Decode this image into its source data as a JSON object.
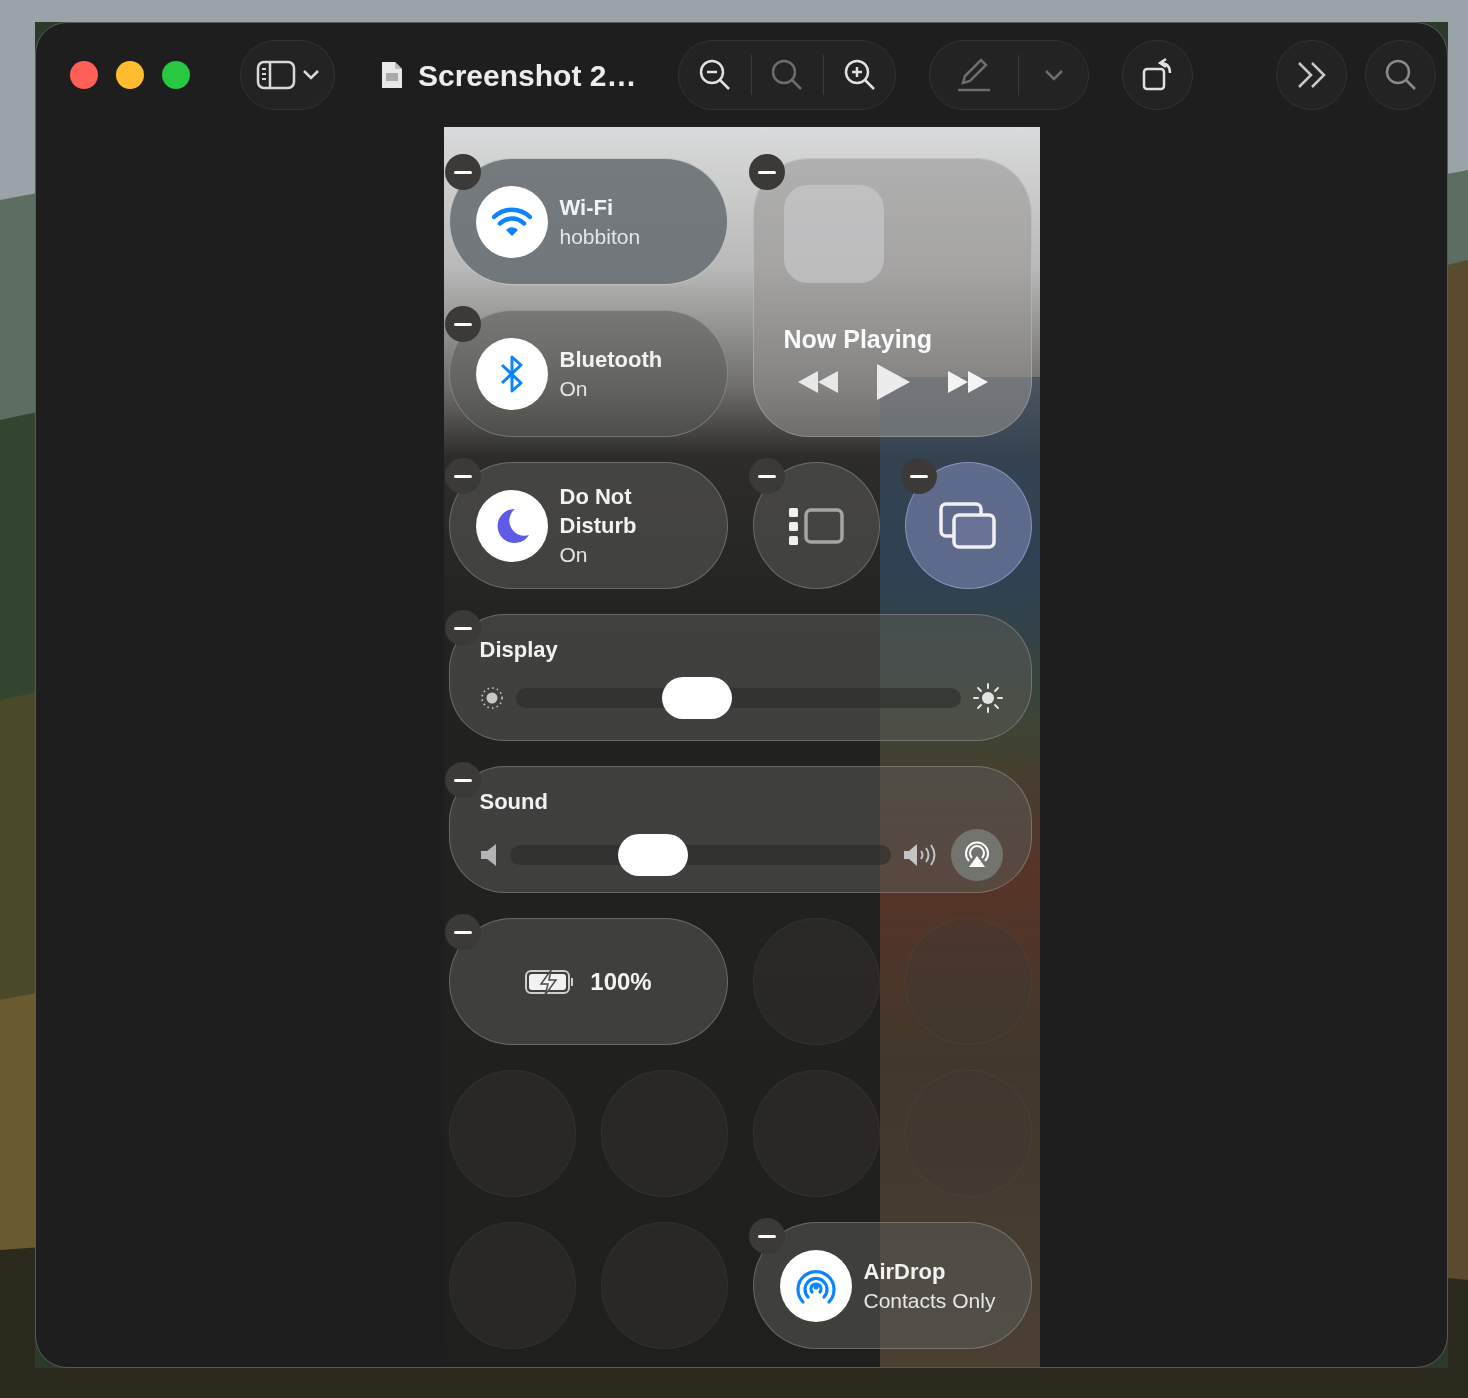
{
  "window": {
    "title": "Screenshot 2…"
  },
  "controls": [
    {
      "kind": "wifi",
      "title": "Wi-Fi",
      "subtitle": "hobbiton",
      "on": true
    },
    {
      "kind": "nowplaying",
      "title": "Now Playing"
    },
    {
      "kind": "bluetooth",
      "title": "Bluetooth",
      "subtitle": "On",
      "on": true
    },
    {
      "kind": "focus",
      "title": "Do Not Disturb",
      "subtitle": "On",
      "on": true
    },
    {
      "kind": "mirroring",
      "on": false
    },
    {
      "kind": "stage",
      "on": true
    },
    {
      "kind": "display",
      "title": "Display",
      "level": 0.39
    },
    {
      "kind": "sound",
      "title": "Sound",
      "level": 0.35
    },
    {
      "kind": "battery",
      "title": "100%"
    },
    {
      "kind": "empty"
    },
    {
      "kind": "empty"
    },
    {
      "kind": "empty"
    },
    {
      "kind": "empty"
    },
    {
      "kind": "empty"
    },
    {
      "kind": "empty"
    },
    {
      "kind": "empty"
    },
    {
      "kind": "empty"
    },
    {
      "kind": "airdrop",
      "title": "AirDrop",
      "subtitle": "Contacts Only",
      "on": true
    }
  ]
}
